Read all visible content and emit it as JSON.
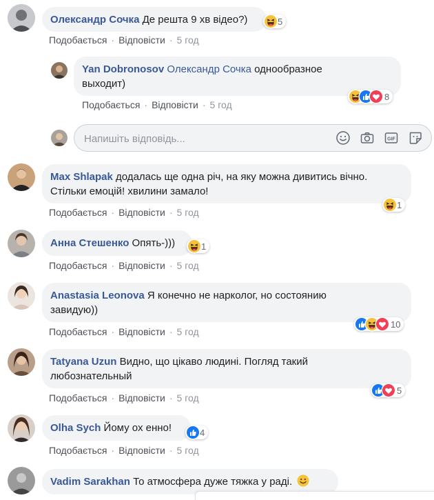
{
  "common": {
    "like": "Подобається",
    "reply": "Відповісти",
    "separator": "·",
    "time": "5 год"
  },
  "comments": [
    {
      "author": "Олександр Сочка",
      "text": "Де решта 9 хв відео?)",
      "reaction_count": "5",
      "reactions": [
        "haha"
      ]
    },
    {
      "author": "Yan Dobronosov",
      "mention": "Олександр Сочка",
      "text_line1": "однообразное",
      "text_line2": "выходит)",
      "reaction_count": "8",
      "reactions": [
        "haha",
        "like",
        "love"
      ]
    },
    {
      "author": "Max Shlapak",
      "text_line1": "додалась ще одна річ, на яку можна дивитись вічно.",
      "text_line2": "Стільки емоцій! хвилини замало!",
      "reaction_count": "1",
      "reactions": [
        "haha"
      ]
    },
    {
      "author": "Анна Стешенко",
      "text": "Опять-)))",
      "reaction_count": "1",
      "reactions": [
        "haha"
      ]
    },
    {
      "author": "Anastasia Leonova",
      "text_line1": "Я конечно не нарколог, но состоянию",
      "text_line2": "завидую))",
      "reaction_count": "10",
      "reactions": [
        "like",
        "haha",
        "love"
      ]
    },
    {
      "author": "Tatyana Uzun",
      "text_line1": "Видно, що цікаво людині. Погляд такий",
      "text_line2": "любознательный",
      "reaction_count": "5",
      "reactions": [
        "like",
        "love"
      ]
    },
    {
      "author": "Olha Sych",
      "text": "Йому ох енно!",
      "reaction_count": "4",
      "reactions": [
        "like"
      ]
    },
    {
      "author": "Vadim Sarakhan",
      "text": "То атмосфера дуже тяжка у раді."
    }
  ],
  "reply_box": {
    "placeholder": "Напишіть відповідь...",
    "tools": [
      "smiley-icon",
      "camera-icon",
      "gif-icon",
      "sticker-icon"
    ]
  },
  "colors": {
    "link": "#385898",
    "bubble": "#f2f3f5",
    "meta": "#606770",
    "like_blue": "#1877f2",
    "love_red": "#f33e58",
    "haha_yellow": "#f7c23b"
  }
}
